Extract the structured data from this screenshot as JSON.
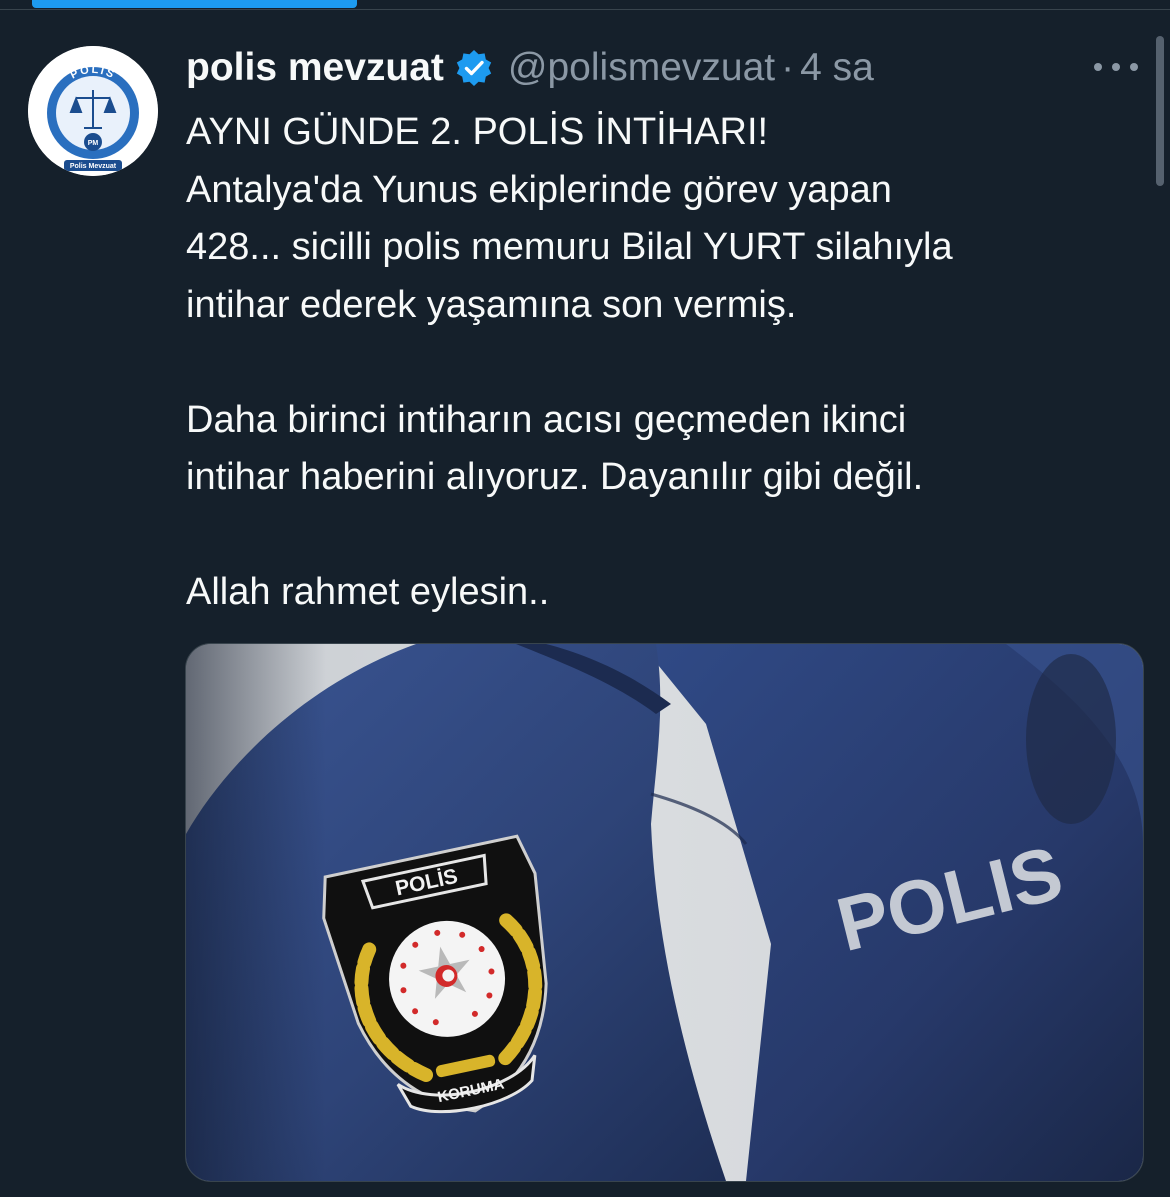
{
  "tweet": {
    "display_name": "polis mevzuat",
    "handle": "@polismevzuat",
    "separator": "·",
    "time": "4 sa",
    "avatar": {
      "ring_text": "POLİS",
      "caption": "Polis Mevzuat",
      "badge": "PM"
    },
    "text": {
      "headline": "AYNI GÜNDE 2. POLİS İNTİHARI!",
      "line1": "Antalya'da Yunus ekiplerinde görev yapan",
      "line2": "428... sicilli polis memuru Bilal YURT silahıyla",
      "line3": "intihar ederek yaşamına son vermiş.",
      "line4": "Daha birinci intiharın acısı geçmeden ikinci",
      "line5": "intihar haberini alıyoruz. Dayanılır gibi değil.",
      "line6": "Allah rahmet eylesin.."
    },
    "media": {
      "patch_top_text": "POLİS",
      "patch_bottom_text": "KORUMA",
      "back_text": "POLIS"
    }
  },
  "icons": {
    "verified": "verified-badge-icon",
    "more": "more-icon"
  },
  "colors": {
    "background": "#15202b",
    "accent": "#1d9bf0",
    "secondary_text": "#8b98a5",
    "uniform_blue": "#2e4478"
  }
}
